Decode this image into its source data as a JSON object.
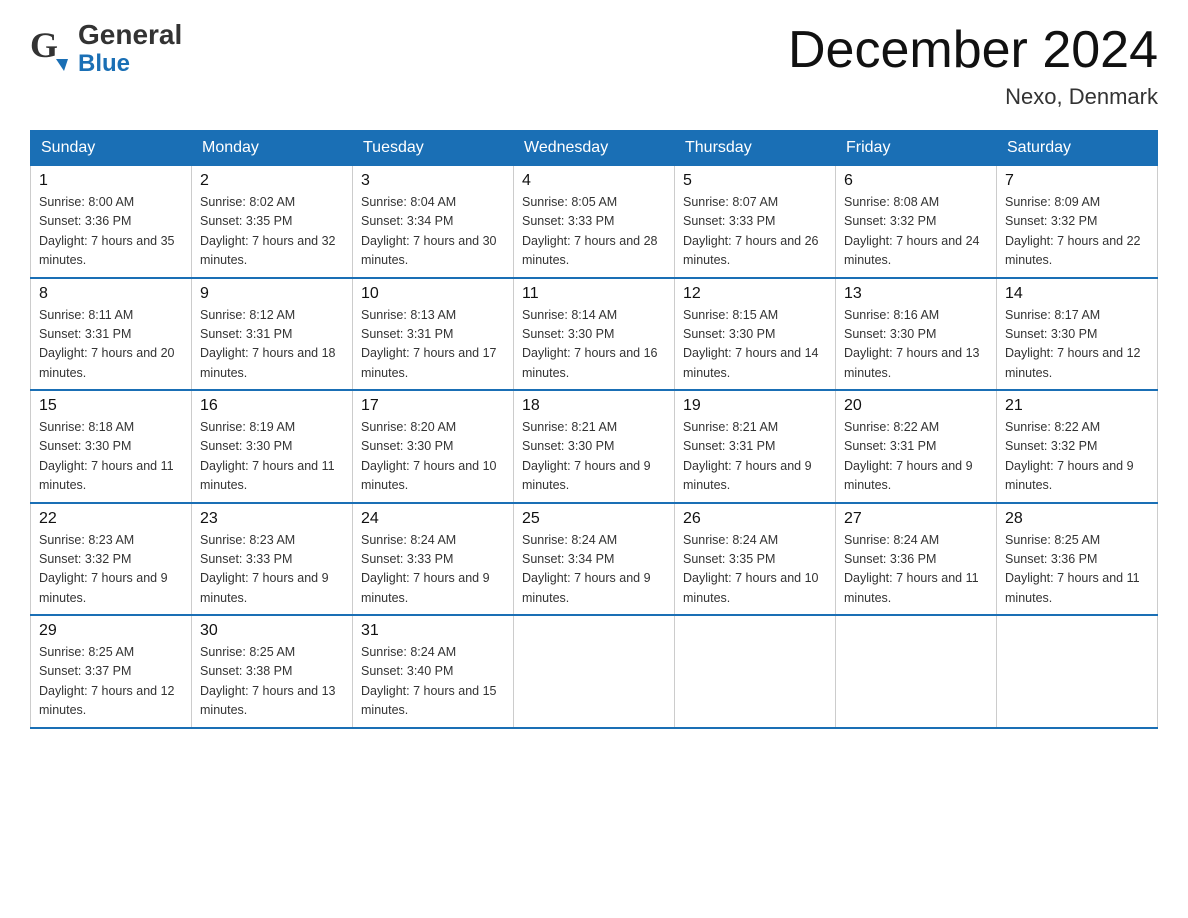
{
  "header": {
    "month_title": "December 2024",
    "location": "Nexo, Denmark",
    "logo_general": "General",
    "logo_blue": "Blue"
  },
  "weekdays": [
    "Sunday",
    "Monday",
    "Tuesday",
    "Wednesday",
    "Thursday",
    "Friday",
    "Saturday"
  ],
  "rows": [
    [
      {
        "day": "1",
        "sunrise": "8:00 AM",
        "sunset": "3:36 PM",
        "daylight": "7 hours and 35 minutes."
      },
      {
        "day": "2",
        "sunrise": "8:02 AM",
        "sunset": "3:35 PM",
        "daylight": "7 hours and 32 minutes."
      },
      {
        "day": "3",
        "sunrise": "8:04 AM",
        "sunset": "3:34 PM",
        "daylight": "7 hours and 30 minutes."
      },
      {
        "day": "4",
        "sunrise": "8:05 AM",
        "sunset": "3:33 PM",
        "daylight": "7 hours and 28 minutes."
      },
      {
        "day": "5",
        "sunrise": "8:07 AM",
        "sunset": "3:33 PM",
        "daylight": "7 hours and 26 minutes."
      },
      {
        "day": "6",
        "sunrise": "8:08 AM",
        "sunset": "3:32 PM",
        "daylight": "7 hours and 24 minutes."
      },
      {
        "day": "7",
        "sunrise": "8:09 AM",
        "sunset": "3:32 PM",
        "daylight": "7 hours and 22 minutes."
      }
    ],
    [
      {
        "day": "8",
        "sunrise": "8:11 AM",
        "sunset": "3:31 PM",
        "daylight": "7 hours and 20 minutes."
      },
      {
        "day": "9",
        "sunrise": "8:12 AM",
        "sunset": "3:31 PM",
        "daylight": "7 hours and 18 minutes."
      },
      {
        "day": "10",
        "sunrise": "8:13 AM",
        "sunset": "3:31 PM",
        "daylight": "7 hours and 17 minutes."
      },
      {
        "day": "11",
        "sunrise": "8:14 AM",
        "sunset": "3:30 PM",
        "daylight": "7 hours and 16 minutes."
      },
      {
        "day": "12",
        "sunrise": "8:15 AM",
        "sunset": "3:30 PM",
        "daylight": "7 hours and 14 minutes."
      },
      {
        "day": "13",
        "sunrise": "8:16 AM",
        "sunset": "3:30 PM",
        "daylight": "7 hours and 13 minutes."
      },
      {
        "day": "14",
        "sunrise": "8:17 AM",
        "sunset": "3:30 PM",
        "daylight": "7 hours and 12 minutes."
      }
    ],
    [
      {
        "day": "15",
        "sunrise": "8:18 AM",
        "sunset": "3:30 PM",
        "daylight": "7 hours and 11 minutes."
      },
      {
        "day": "16",
        "sunrise": "8:19 AM",
        "sunset": "3:30 PM",
        "daylight": "7 hours and 11 minutes."
      },
      {
        "day": "17",
        "sunrise": "8:20 AM",
        "sunset": "3:30 PM",
        "daylight": "7 hours and 10 minutes."
      },
      {
        "day": "18",
        "sunrise": "8:21 AM",
        "sunset": "3:30 PM",
        "daylight": "7 hours and 9 minutes."
      },
      {
        "day": "19",
        "sunrise": "8:21 AM",
        "sunset": "3:31 PM",
        "daylight": "7 hours and 9 minutes."
      },
      {
        "day": "20",
        "sunrise": "8:22 AM",
        "sunset": "3:31 PM",
        "daylight": "7 hours and 9 minutes."
      },
      {
        "day": "21",
        "sunrise": "8:22 AM",
        "sunset": "3:32 PM",
        "daylight": "7 hours and 9 minutes."
      }
    ],
    [
      {
        "day": "22",
        "sunrise": "8:23 AM",
        "sunset": "3:32 PM",
        "daylight": "7 hours and 9 minutes."
      },
      {
        "day": "23",
        "sunrise": "8:23 AM",
        "sunset": "3:33 PM",
        "daylight": "7 hours and 9 minutes."
      },
      {
        "day": "24",
        "sunrise": "8:24 AM",
        "sunset": "3:33 PM",
        "daylight": "7 hours and 9 minutes."
      },
      {
        "day": "25",
        "sunrise": "8:24 AM",
        "sunset": "3:34 PM",
        "daylight": "7 hours and 9 minutes."
      },
      {
        "day": "26",
        "sunrise": "8:24 AM",
        "sunset": "3:35 PM",
        "daylight": "7 hours and 10 minutes."
      },
      {
        "day": "27",
        "sunrise": "8:24 AM",
        "sunset": "3:36 PM",
        "daylight": "7 hours and 11 minutes."
      },
      {
        "day": "28",
        "sunrise": "8:25 AM",
        "sunset": "3:36 PM",
        "daylight": "7 hours and 11 minutes."
      }
    ],
    [
      {
        "day": "29",
        "sunrise": "8:25 AM",
        "sunset": "3:37 PM",
        "daylight": "7 hours and 12 minutes."
      },
      {
        "day": "30",
        "sunrise": "8:25 AM",
        "sunset": "3:38 PM",
        "daylight": "7 hours and 13 minutes."
      },
      {
        "day": "31",
        "sunrise": "8:24 AM",
        "sunset": "3:40 PM",
        "daylight": "7 hours and 15 minutes."
      },
      null,
      null,
      null,
      null
    ]
  ]
}
